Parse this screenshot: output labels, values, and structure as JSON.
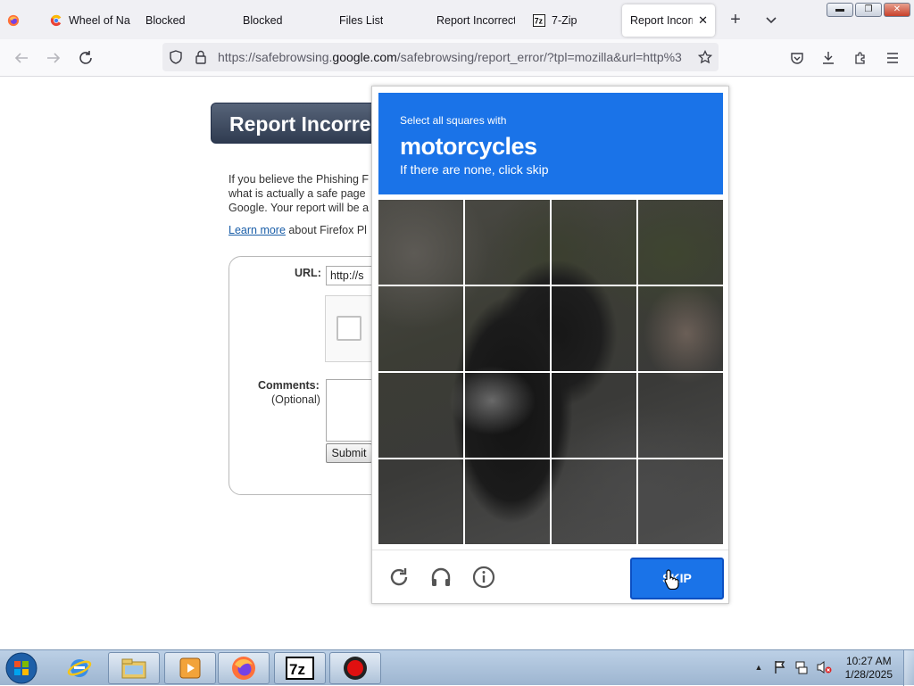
{
  "browser": {
    "tabs": [
      {
        "label": "",
        "icon": "firefox-icon",
        "active": false
      },
      {
        "label": "Wheel of Na",
        "icon": "colorful-c-icon",
        "active": false
      },
      {
        "label": "Blocked",
        "icon": "",
        "active": false
      },
      {
        "label": "Blocked",
        "icon": "",
        "active": false
      },
      {
        "label": "Files List",
        "icon": "",
        "active": false
      },
      {
        "label": "Report Incorrect",
        "icon": "",
        "active": false
      },
      {
        "label": "7-Zip",
        "icon": "7zip-icon",
        "active": false
      },
      {
        "label": "Report Incorr",
        "icon": "",
        "active": true
      }
    ],
    "url_prefix": "https://safebrowsing.",
    "url_domain": "google.com",
    "url_rest": "/safebrowsing/report_error/?tpl=mozilla&url=http%3"
  },
  "page": {
    "header_title": "Report Incorre",
    "paragraph_lines": [
      "If you believe the Phishing F",
      "what is actually a safe page",
      "Google. Your report will be a"
    ],
    "learn_more_link": "Learn more",
    "learn_more_suffix": " about Firefox Pl",
    "url_label": "URL:",
    "url_value": "http://s",
    "comments_label": "Comments:",
    "optional_label": "(Optional)",
    "submit_label": "Submit"
  },
  "captcha": {
    "instruction_small": "Select all squares with",
    "target_word": "motorcycles",
    "instruction_hint": "If there are none, click skip",
    "skip_label": "SKIP",
    "grid_size": 4,
    "colors": {
      "header": "#1a73e8",
      "skip": "#1a73e8"
    }
  },
  "taskbar": {
    "time": "10:27 AM",
    "date": "1/28/2025",
    "apps": [
      "internet-explorer-icon",
      "file-explorer-icon",
      "media-player-icon",
      "firefox-icon",
      "7zip-icon",
      "recorder-icon"
    ]
  }
}
